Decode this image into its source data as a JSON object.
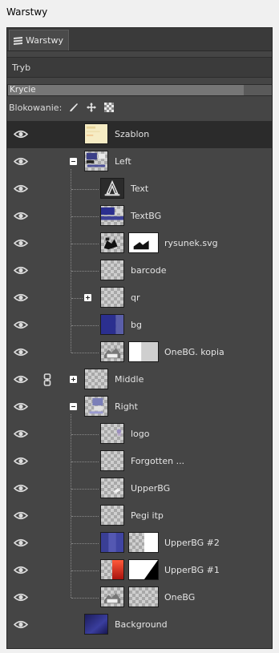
{
  "window": {
    "title": "Warstwy"
  },
  "tab": {
    "label": "Warstwy",
    "icon": "layers-icon"
  },
  "mode": {
    "label": "Tryb"
  },
  "opacity": {
    "label": "Krycie",
    "fraction": 0.89
  },
  "lock": {
    "label": "Blokowanie:",
    "icons": [
      "brush-lock-icon",
      "move-lock-icon",
      "alpha-lock-icon"
    ]
  },
  "layers": [
    {
      "name": "Szablon",
      "depth": 0,
      "expander": "none",
      "selected": true,
      "thumb": "szablon",
      "mask": null,
      "chain": false
    },
    {
      "name": "Left",
      "depth": 0,
      "expander": "collapse",
      "selected": false,
      "thumb": "left",
      "mask": null,
      "chain": false
    },
    {
      "name": "Text",
      "depth": 1,
      "expander": "none",
      "selected": false,
      "thumb": "text",
      "mask": null,
      "chain": false
    },
    {
      "name": "TextBG",
      "depth": 1,
      "expander": "none",
      "selected": false,
      "thumb": "textbg",
      "mask": null,
      "chain": false
    },
    {
      "name": "rysunek.svg",
      "depth": 1,
      "expander": "none",
      "selected": false,
      "thumb": "rysunek",
      "mask": "rysunek-mask",
      "chain": false
    },
    {
      "name": "barcode",
      "depth": 1,
      "expander": "none",
      "selected": false,
      "thumb": "transparent",
      "mask": null,
      "chain": false
    },
    {
      "name": "qr",
      "depth": 1,
      "expander": "expand",
      "selected": false,
      "thumb": "transparent",
      "mask": null,
      "chain": false
    },
    {
      "name": "bg",
      "depth": 1,
      "expander": "none",
      "selected": false,
      "thumb": "bg",
      "mask": null,
      "chain": false
    },
    {
      "name": "OneBG. kopia",
      "depth": 1,
      "expander": "none",
      "selected": false,
      "thumb": "onebg",
      "mask": "white-half",
      "chain": false
    },
    {
      "name": "Middle",
      "depth": 0,
      "expander": "expand",
      "selected": false,
      "thumb": "transparent",
      "mask": null,
      "chain": true
    },
    {
      "name": "Right",
      "depth": 0,
      "expander": "collapse",
      "selected": false,
      "thumb": "right",
      "mask": null,
      "chain": false
    },
    {
      "name": "logo",
      "depth": 1,
      "expander": "none",
      "selected": false,
      "thumb": "logo",
      "mask": null,
      "chain": false
    },
    {
      "name": "Forgotten ...",
      "depth": 1,
      "expander": "none",
      "selected": false,
      "thumb": "transparent",
      "mask": null,
      "chain": false
    },
    {
      "name": "UpperBG",
      "depth": 1,
      "expander": "none",
      "selected": false,
      "thumb": "upperbg",
      "mask": null,
      "chain": false
    },
    {
      "name": "Pegi itp",
      "depth": 1,
      "expander": "none",
      "selected": false,
      "thumb": "transparent",
      "mask": null,
      "chain": false
    },
    {
      "name": "UpperBG #2",
      "depth": 1,
      "expander": "none",
      "selected": false,
      "thumb": "upperbg2",
      "mask": "white-right",
      "chain": false
    },
    {
      "name": "UpperBG #1",
      "depth": 1,
      "expander": "none",
      "selected": false,
      "thumb": "upperbg1",
      "mask": "diagonal",
      "chain": false
    },
    {
      "name": "OneBG",
      "depth": 1,
      "expander": "none",
      "selected": false,
      "thumb": "onebg",
      "mask": "transparent",
      "chain": false
    },
    {
      "name": "Background",
      "depth": 0,
      "expander": "none",
      "selected": false,
      "thumb": "background",
      "mask": null,
      "chain": false
    }
  ],
  "colors": {
    "panel_bg": "#454545",
    "selected_row": "#2b2b2b",
    "text": "#e4e4e4",
    "accent_blue": "#2b2f8f",
    "accent_red": "#c52a1d"
  }
}
